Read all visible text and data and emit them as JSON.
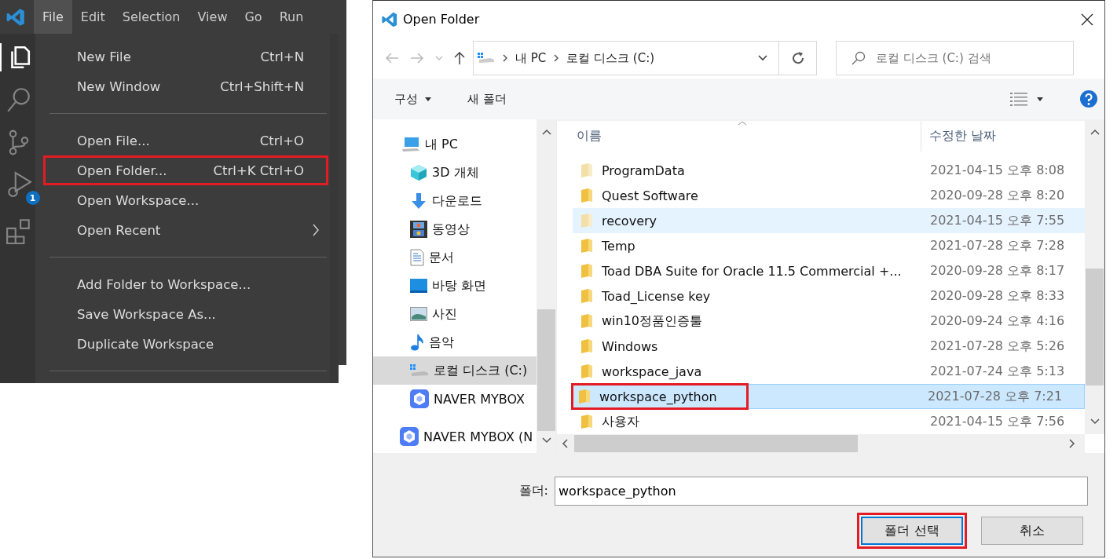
{
  "menubar": {
    "items": [
      {
        "label": "File",
        "selected": true
      },
      {
        "label": "Edit",
        "selected": false
      },
      {
        "label": "Selection",
        "selected": false
      },
      {
        "label": "View",
        "selected": false
      },
      {
        "label": "Go",
        "selected": false
      },
      {
        "label": "Run",
        "selected": false
      }
    ]
  },
  "activity_bar": {
    "items": [
      {
        "kind": "files",
        "selected": true
      },
      {
        "kind": "search",
        "selected": false
      },
      {
        "kind": "source-control",
        "selected": false
      },
      {
        "kind": "debug",
        "selected": false,
        "badge": "1"
      },
      {
        "kind": "extensions",
        "selected": false
      }
    ]
  },
  "file_menu": [
    {
      "kind": "item",
      "label": "New File",
      "shortcut": "Ctrl+N",
      "annotated": false,
      "submenu": false
    },
    {
      "kind": "item",
      "label": "New Window",
      "shortcut": "Ctrl+Shift+N",
      "annotated": false,
      "submenu": false
    },
    {
      "kind": "separator"
    },
    {
      "kind": "item",
      "label": "Open File...",
      "shortcut": "Ctrl+O",
      "annotated": false,
      "submenu": false
    },
    {
      "kind": "item",
      "label": "Open Folder...",
      "shortcut": "Ctrl+K Ctrl+O",
      "annotated": true,
      "submenu": false
    },
    {
      "kind": "item",
      "label": "Open Workspace...",
      "annotated": false,
      "submenu": false
    },
    {
      "kind": "item",
      "label": "Open Recent",
      "annotated": false,
      "submenu": true
    },
    {
      "kind": "separator"
    },
    {
      "kind": "item",
      "label": "Add Folder to Workspace...",
      "annotated": false,
      "submenu": false
    },
    {
      "kind": "item",
      "label": "Save Workspace As...",
      "annotated": false,
      "submenu": false
    },
    {
      "kind": "item",
      "label": "Duplicate Workspace",
      "annotated": false,
      "submenu": false
    },
    {
      "kind": "separator"
    }
  ],
  "dialog": {
    "title": "Open Folder",
    "breadcrumb": [
      "내 PC",
      "로컬 디스크 (C:)"
    ],
    "search": {
      "placeholder": "로컬 디스크 (C:) 검색"
    },
    "toolbar": [
      "구성",
      "새 폴더"
    ],
    "nav_tree": [
      {
        "label": "내 PC",
        "kind": "pc",
        "selected": false,
        "children": [
          {
            "label": "3D 개체",
            "kind": "cube",
            "selected": false
          },
          {
            "label": "다운로드",
            "kind": "download",
            "selected": false
          },
          {
            "label": "동영상",
            "kind": "video",
            "selected": false
          },
          {
            "label": "문서",
            "kind": "document",
            "selected": false
          },
          {
            "label": "바탕 화면",
            "kind": "desktop",
            "selected": false
          },
          {
            "label": "사진",
            "kind": "picture",
            "selected": false
          },
          {
            "label": "음악",
            "kind": "music",
            "selected": false
          },
          {
            "label": "로컬 디스크 (C:)",
            "kind": "drive",
            "selected": true
          },
          {
            "label": "NAVER MYBOX",
            "kind": "cloud",
            "selected": false
          }
        ]
      },
      {
        "label": "NAVER MYBOX (N",
        "kind": "cloud",
        "selected": false
      }
    ],
    "columns": [
      "이름",
      "수정한 날짜"
    ],
    "rows": [
      {
        "name": "ProgramData",
        "date": "2021-04-15 오후 8:08",
        "selected": false,
        "hovered": false,
        "annotated": false,
        "faded": true
      },
      {
        "name": "Quest Software",
        "date": "2020-09-28 오후 8:20",
        "selected": false,
        "hovered": false,
        "annotated": false,
        "faded": false
      },
      {
        "name": "recovery",
        "date": "2021-04-15 오후 7:55",
        "selected": false,
        "hovered": true,
        "annotated": false,
        "faded": true
      },
      {
        "name": "Temp",
        "date": "2021-07-28 오후 7:28",
        "selected": false,
        "hovered": false,
        "annotated": false,
        "faded": false
      },
      {
        "name": "Toad DBA Suite for Oracle 11.5 Commercial +...",
        "date": "2020-09-28 오후 8:17",
        "selected": false,
        "hovered": false,
        "annotated": false,
        "faded": false
      },
      {
        "name": "Toad_License key",
        "date": "2020-09-28 오후 8:33",
        "selected": false,
        "hovered": false,
        "annotated": false,
        "faded": false
      },
      {
        "name": "win10정품인증툴",
        "date": "2020-09-24 오후 4:16",
        "selected": false,
        "hovered": false,
        "annotated": false,
        "faded": false
      },
      {
        "name": "Windows",
        "date": "2021-07-28 오후 5:26",
        "selected": false,
        "hovered": false,
        "annotated": false,
        "faded": false
      },
      {
        "name": "workspace_java",
        "date": "2021-07-24 오후 5:13",
        "selected": false,
        "hovered": false,
        "annotated": false,
        "faded": false
      },
      {
        "name": "workspace_python",
        "date": "2021-07-28 오후 7:21",
        "selected": true,
        "hovered": false,
        "annotated": true,
        "faded": false
      },
      {
        "name": "사용자",
        "date": "2021-04-15 오후 7:56",
        "selected": false,
        "hovered": false,
        "annotated": false,
        "faded": false
      }
    ],
    "folder_label": "폴더:",
    "folder_value": "workspace_python",
    "buttons": [
      {
        "label": "폴더 선택",
        "kind": "primary",
        "annotated": true
      },
      {
        "label": "취소",
        "kind": "normal",
        "annotated": false
      }
    ]
  }
}
